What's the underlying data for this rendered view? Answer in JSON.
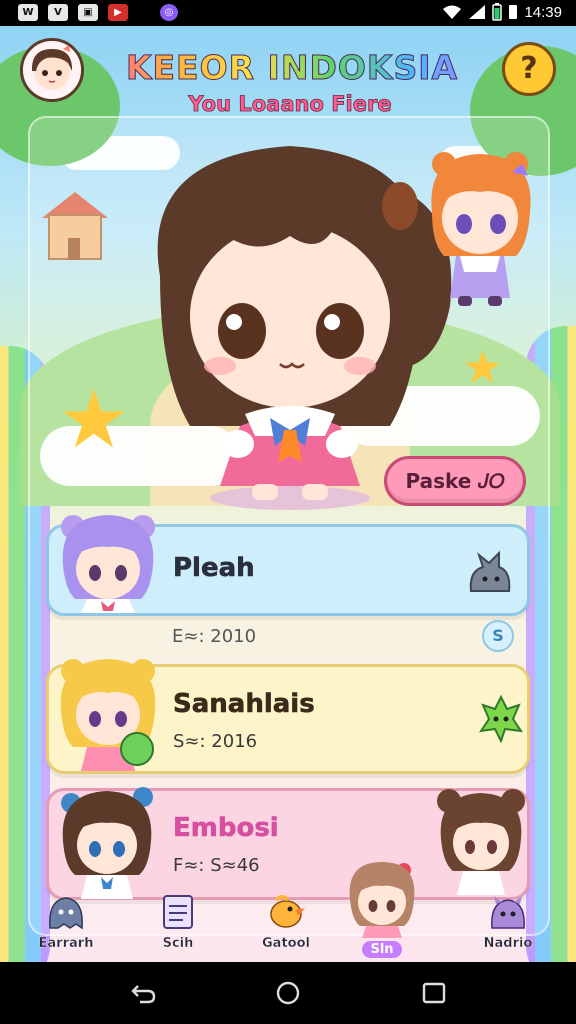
{
  "status_bar": {
    "left_icons": [
      {
        "name": "wb-notification-icon",
        "glyph": "W"
      },
      {
        "name": "v-notification-icon",
        "glyph": "V"
      },
      {
        "name": "image-notification-icon",
        "glyph": "▣"
      },
      {
        "name": "youtube-notification-icon",
        "glyph": "▶"
      },
      {
        "name": "messenger-notification-icon",
        "glyph": "◎"
      }
    ],
    "time": "14:39"
  },
  "header": {
    "title": "KEEOR INDOKSIA",
    "subtitle": "You Loaano Fiere",
    "help_glyph": "?"
  },
  "hero_button": {
    "label": "Paske 𝐽𝑂"
  },
  "cards": [
    {
      "name": "Pleah",
      "sub": "E≈: 2010"
    },
    {
      "name": "Sanahlais",
      "sub": "S≈: 2016"
    },
    {
      "name": "Embosi",
      "sub": "F≈: S≈46"
    }
  ],
  "info_glyph": "S",
  "bottom_nav": [
    {
      "label": "Earrarh",
      "icon": "ghost-pet-icon"
    },
    {
      "label": "Scih",
      "icon": "notepad-icon"
    },
    {
      "label": "Gatool",
      "icon": "bird-pet-icon"
    },
    {
      "label": "Sln",
      "icon": "chibi-girl-icon"
    },
    {
      "label": "Nadrio",
      "icon": "purple-pet-icon"
    }
  ],
  "colors": {
    "accent_pink": "#ff9bb8",
    "card_blue": "#cfeefc",
    "card_yellow": "#fdf4c9",
    "card_pink": "#fbd6e2"
  }
}
